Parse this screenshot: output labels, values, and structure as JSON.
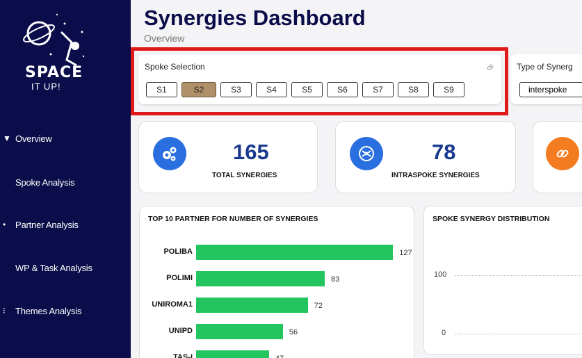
{
  "app": {
    "title": "Synergies Dashboard",
    "subtitle": "Overview"
  },
  "sidebar": {
    "logo_text": "SPACE",
    "logo_sub": "IT UP!",
    "items": [
      {
        "label": "Overview",
        "bullet": "▼"
      },
      {
        "label": "Spoke Analysis",
        "bullet": ""
      },
      {
        "label": "Partner Analysis",
        "bullet": "•"
      },
      {
        "label": "WP & Task Analysis",
        "bullet": ""
      },
      {
        "label": "Themes Analysis",
        "bullet": "⁝"
      }
    ]
  },
  "spoke_selection": {
    "label": "Spoke Selection",
    "options": [
      "S1",
      "S2",
      "S3",
      "S4",
      "S5",
      "S6",
      "S7",
      "S8",
      "S9"
    ],
    "selected": "S2"
  },
  "type_of_synergy": {
    "label": "Type of Synerg",
    "value": "interspoke"
  },
  "kpis": [
    {
      "value": "165",
      "label": "TOTAL SYNERGIES",
      "icon": "gears-icon",
      "color": "#2a6fe0"
    },
    {
      "value": "78",
      "label": "INTRASPOKE SYNERGIES",
      "icon": "cycle-icon",
      "color": "#2a6fe0"
    },
    {
      "value": "",
      "label": "",
      "icon": "link-icon",
      "color": "#f47c20"
    }
  ],
  "partner_panel": {
    "title": "TOP 10 PARTNER FOR NUMBER OF SYNERGIES"
  },
  "distribution_panel": {
    "title": "SPOKE SYNERGY DISTRIBUTION",
    "ticks": [
      "100",
      "0"
    ]
  },
  "chart_data": {
    "type": "bar",
    "orientation": "horizontal",
    "categories": [
      "POLIBA",
      "POLIMI",
      "UNIROMA1",
      "UNIPD",
      "TAS-I"
    ],
    "values": [
      127,
      83,
      72,
      56,
      47
    ],
    "color": "#22c55e"
  }
}
